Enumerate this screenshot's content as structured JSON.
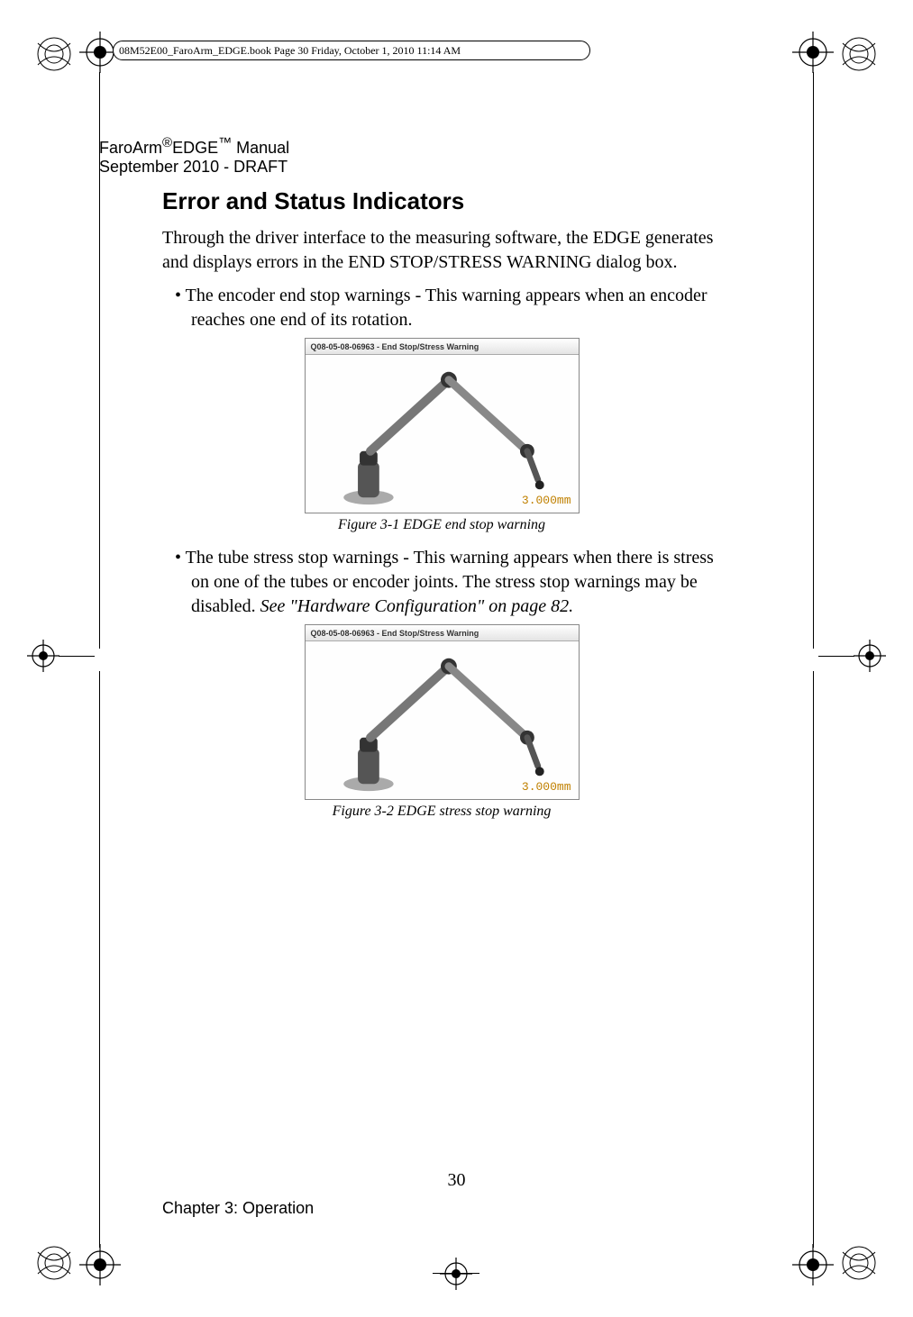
{
  "print_header": {
    "text": "08M52E00_FaroArm_EDGE.book  Page 30  Friday, October 1, 2010  11:14 AM"
  },
  "doc_header": {
    "line1_pre": "FaroArm",
    "line1_reg": "®",
    "line1_mid": "EDGE",
    "line1_tm": "™",
    "line1_post": " Manual",
    "line2": "September 2010 - DRAFT"
  },
  "section_heading": "Error and Status Indicators",
  "para1_pre": "Through the driver interface to the measuring software, the EDGE generates and displays errors in the E",
  "para1_sc": "ND STOP/STRESS WARNING",
  "para1_post": " dialog box.",
  "bullet1": "The encoder end stop warnings - This warning appears when an encoder reaches one end of its rotation.",
  "figure1": {
    "titlebar": "Q08-05-08-06963 - End Stop/Stress Warning",
    "readout": "3.000mm",
    "caption": "Figure 3-1 EDGE end stop warning"
  },
  "bullet2_pre": "The tube stress stop warnings - This warning appears when there is stress on one of the tubes or encoder joints. The stress stop warnings may be disabled. ",
  "bullet2_ital": "See \"Hardware Configuration\" on page 82.",
  "figure2": {
    "titlebar": "Q08-05-08-06963 - End Stop/Stress Warning",
    "readout": "3.000mm",
    "caption": "Figure 3-2 EDGE stress stop warning"
  },
  "page_number": "30",
  "chapter_footer": "Chapter 3: Operation"
}
